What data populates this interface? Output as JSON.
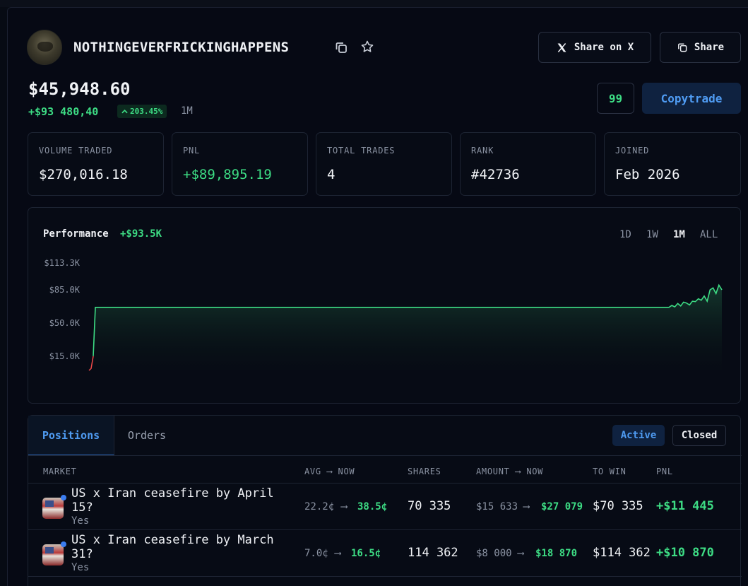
{
  "profile": {
    "username": "NOTHINGEVERFRICKINGHAPPENS",
    "balance": "$45,948.60",
    "gain": "+$93 480,40",
    "gain_pct": "203.45%",
    "period": "1M"
  },
  "header_buttons": {
    "share_x": "Share on X",
    "share": "Share",
    "count": "99",
    "copytrade": "Copytrade"
  },
  "stats": [
    {
      "label": "VOLUME TRADED",
      "value": "$270,016.18"
    },
    {
      "label": "PNL",
      "value": "+$89,895.19"
    },
    {
      "label": "TOTAL TRADES",
      "value": "4"
    },
    {
      "label": "RANK",
      "value": "#42736"
    },
    {
      "label": "JOINED",
      "value": "Feb 2026"
    }
  ],
  "performance": {
    "label": "Performance",
    "value": "+$93.5K",
    "ranges": [
      "1D",
      "1W",
      "1M",
      "ALL"
    ],
    "active_range": "1M"
  },
  "chart_data": {
    "type": "area",
    "title": "",
    "xlabel": "",
    "ylabel": "",
    "y_ticks": [
      "$113.3K",
      "$85.0K",
      "$50.0K",
      "$15.0K"
    ],
    "ylim": [
      0,
      113300
    ],
    "grid": false,
    "legend": "none",
    "series": [
      {
        "values": [
          0,
          2000,
          15000,
          66500,
          66500,
          66500,
          66500,
          66500,
          66500,
          66500,
          66500,
          66500,
          66500,
          66500,
          66500,
          66500,
          68500,
          67000,
          70500,
          68000,
          72000,
          71000,
          69000,
          73000,
          72500,
          75500,
          74000,
          78500,
          73000,
          85000,
          87000,
          81000,
          90000,
          85000
        ]
      }
    ],
    "colors": {
      "line": "#3ddc84",
      "start": "#f04a4a"
    }
  },
  "positions": {
    "tabs": [
      "Positions",
      "Orders"
    ],
    "filters": {
      "active": "Active",
      "closed": "Closed"
    },
    "columns": {
      "market": "MARKET",
      "avg_now": "AVG ⟶ NOW",
      "shares": "SHARES",
      "amount_now": "AMOUNT ⟶ NOW",
      "to_win": "TO WIN",
      "pnl": "PNL"
    },
    "rows": [
      {
        "title": "US x Iran ceasefire by April 15?",
        "outcome": "Yes",
        "avg": "22.2¢",
        "now": "38.5¢",
        "shares": "70 335",
        "amount": "$15 633",
        "amount_now": "$27 079",
        "to_win": "$70 335",
        "pnl": "+$11 445"
      },
      {
        "title": "US x Iran ceasefire by March 31?",
        "outcome": "Yes",
        "avg": "7.0¢",
        "now": "16.5¢",
        "shares": "114 362",
        "amount": "$8 000",
        "amount_now": "$18 870",
        "to_win": "$114 362",
        "pnl": "+$10 870"
      }
    ]
  }
}
